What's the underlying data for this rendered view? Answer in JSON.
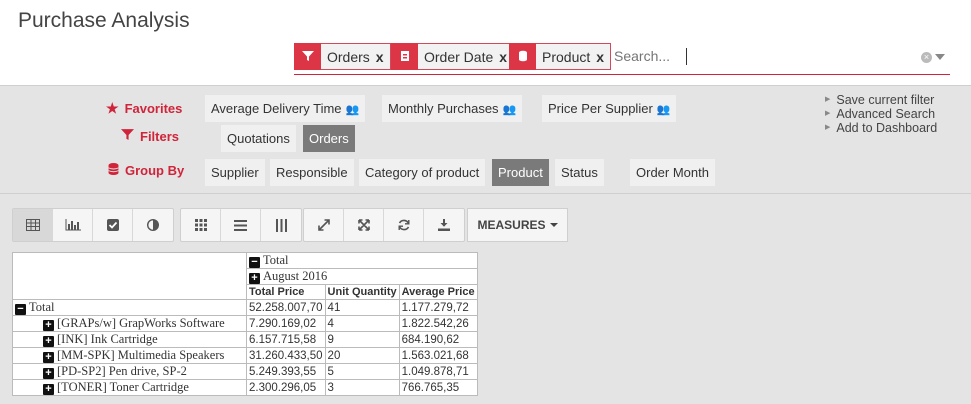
{
  "page": {
    "title": "Purchase Analysis"
  },
  "search": {
    "facets": [
      {
        "icon": "filter-icon",
        "label": "Orders",
        "remove": "x"
      },
      {
        "icon": "group-by-icon",
        "label": "Order Date",
        "remove": "x"
      },
      {
        "icon": "group-by-icon",
        "label": "Product",
        "remove": "x"
      }
    ],
    "placeholder": "Search..."
  },
  "filters_panel": {
    "favorites_label": "Favorites",
    "filters_label": "Filters",
    "groupby_label": "Group By",
    "favorites": [
      "Average Delivery Time",
      "Monthly Purchases",
      "Price Per Supplier"
    ],
    "filters": [
      {
        "label": "Quotations",
        "active": false
      },
      {
        "label": "Orders",
        "active": true
      }
    ],
    "groupby": [
      {
        "label": "Supplier",
        "active": false
      },
      {
        "label": "Responsible",
        "active": false
      },
      {
        "label": "Category of product",
        "active": false
      },
      {
        "label": "Product",
        "active": true
      },
      {
        "label": "Status",
        "active": false
      },
      {
        "label": "Order Month",
        "active": false
      }
    ],
    "side_links": [
      "Save current filter",
      "Advanced Search",
      "Add to Dashboard"
    ]
  },
  "toolbar": {
    "measures_label": "MEASURES"
  },
  "pivot": {
    "col_total": "Total",
    "col_group": "August 2016",
    "measures": [
      "Total Price",
      "Unit Quantity",
      "Average Price"
    ],
    "row_total": {
      "label": "Total",
      "values": [
        "52.258.007,70",
        "41",
        "1.177.279,72"
      ]
    },
    "rows": [
      {
        "label": "[GRAPs/w] GrapWorks Software",
        "values": [
          "7.290.169,02",
          "4",
          "1.822.542,26"
        ]
      },
      {
        "label": "[INK] Ink Cartridge",
        "values": [
          "6.157.715,58",
          "9",
          "684.190,62"
        ]
      },
      {
        "label": "[MM-SPK] Multimedia Speakers",
        "values": [
          "31.260.433,50",
          "20",
          "1.563.021,68"
        ]
      },
      {
        "label": "[PD-SP2] Pen drive, SP-2",
        "values": [
          "5.249.393,55",
          "5",
          "1.049.878,71"
        ]
      },
      {
        "label": "[TONER] Toner Cartridge",
        "values": [
          "2.300.296,05",
          "3",
          "766.765,35"
        ]
      }
    ]
  }
}
